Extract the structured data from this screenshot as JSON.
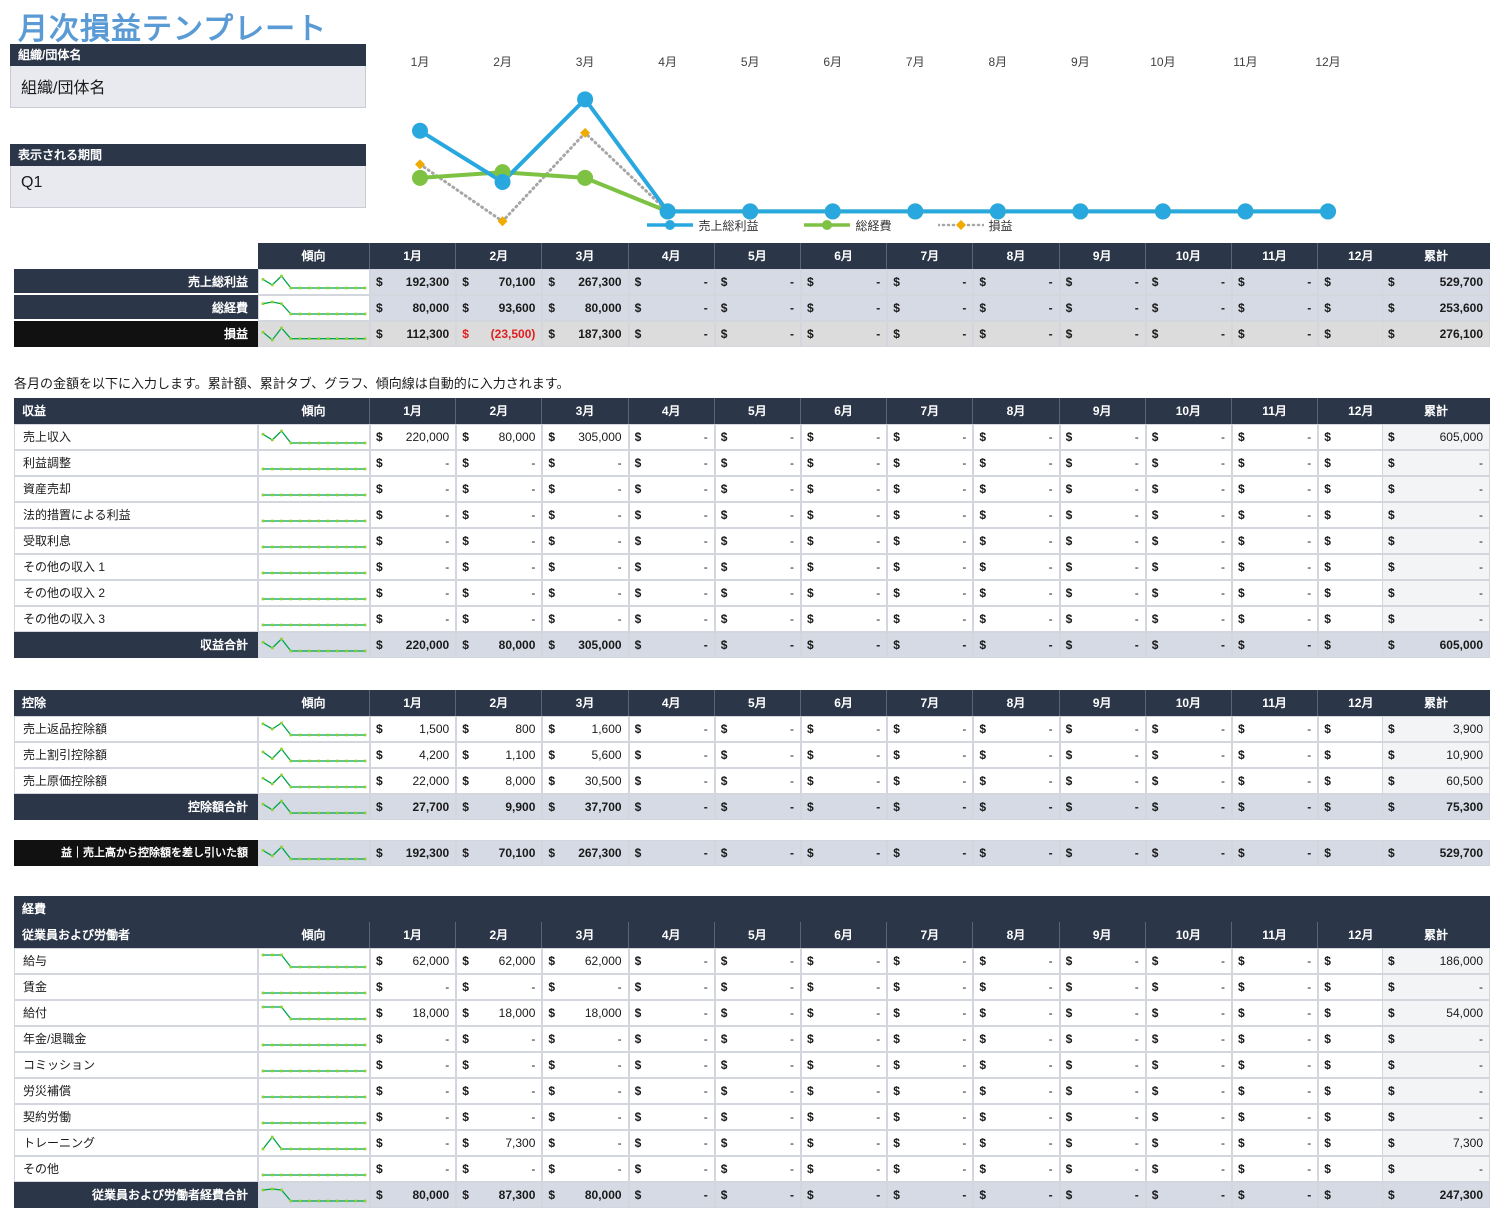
{
  "page": {
    "title": "月次損益テンプレート",
    "currency_symbol": "$",
    "dash": "-",
    "note": "各月の金額を以下に入力します。累計額、累計タブ、グラフ、傾向線は自動的に入力されます。"
  },
  "org_box": {
    "header": "組織/団体名",
    "value": "組織/団体名"
  },
  "period_box": {
    "header": "表示される期間",
    "value": "Q1"
  },
  "columns": {
    "trend": "傾向",
    "months": [
      "1月",
      "2月",
      "3月",
      "4月",
      "5月",
      "6月",
      "7月",
      "8月",
      "9月",
      "10月",
      "11月",
      "12月"
    ],
    "total": "累計"
  },
  "chart_data": {
    "type": "line",
    "title": "",
    "xlabel": "",
    "ylabel": "",
    "x": [
      "1月",
      "2月",
      "3月",
      "4月",
      "5月",
      "6月",
      "7月",
      "8月",
      "9月",
      "10月",
      "11月",
      "12月"
    ],
    "legend_position": "bottom",
    "grid": false,
    "ylim": [
      -30000,
      280000
    ],
    "series": [
      {
        "name": "売上総利益",
        "color": "#29a8e0",
        "marker": "circle",
        "style": "solid",
        "values": [
          192300,
          70100,
          267300,
          0,
          0,
          0,
          0,
          0,
          0,
          0,
          0,
          0
        ]
      },
      {
        "name": "総経費",
        "color": "#7dc242",
        "marker": "circle",
        "style": "solid",
        "values": [
          80000,
          93600,
          80000,
          0,
          0,
          0,
          0,
          0,
          0,
          0,
          0,
          0
        ]
      },
      {
        "name": "損益",
        "color": "#f0ab00",
        "marker": "diamond",
        "style": "dotted",
        "values": [
          112300,
          -23500,
          187300,
          0,
          0,
          0,
          0,
          0,
          0,
          0,
          0,
          0
        ]
      }
    ]
  },
  "summary_table": {
    "rows": [
      {
        "label": "売上総利益",
        "style": "dark",
        "values": [
          "192,300",
          "70,100",
          "267,300",
          "-",
          "-",
          "-",
          "-",
          "-",
          "-",
          "-",
          "-",
          "-"
        ],
        "total": "529,700",
        "negatives": []
      },
      {
        "label": "総経費",
        "style": "dark",
        "values": [
          "80,000",
          "93,600",
          "80,000",
          "-",
          "-",
          "-",
          "-",
          "-",
          "-",
          "-",
          "-",
          "-"
        ],
        "total": "253,600",
        "negatives": []
      },
      {
        "label": "損益",
        "style": "black",
        "values": [
          "112,300",
          "(23,500)",
          "187,300",
          "-",
          "-",
          "-",
          "-",
          "-",
          "-",
          "-",
          "-",
          "-"
        ],
        "total": "276,100",
        "negatives": [
          1
        ]
      }
    ]
  },
  "revenue_table": {
    "section_label": "収益",
    "rows": [
      {
        "label": "売上収入",
        "values": [
          "220,000",
          "80,000",
          "305,000",
          "-",
          "-",
          "-",
          "-",
          "-",
          "-",
          "-",
          "-",
          "-"
        ],
        "total": "605,000"
      },
      {
        "label": "利益調整",
        "values": [
          "-",
          "-",
          "-",
          "-",
          "-",
          "-",
          "-",
          "-",
          "-",
          "-",
          "-",
          "-"
        ],
        "total": "-"
      },
      {
        "label": "資産売却",
        "values": [
          "-",
          "-",
          "-",
          "-",
          "-",
          "-",
          "-",
          "-",
          "-",
          "-",
          "-",
          "-"
        ],
        "total": "-"
      },
      {
        "label": "法的措置による利益",
        "values": [
          "-",
          "-",
          "-",
          "-",
          "-",
          "-",
          "-",
          "-",
          "-",
          "-",
          "-",
          "-"
        ],
        "total": "-"
      },
      {
        "label": "受取利息",
        "values": [
          "-",
          "-",
          "-",
          "-",
          "-",
          "-",
          "-",
          "-",
          "-",
          "-",
          "-",
          "-"
        ],
        "total": "-"
      },
      {
        "label": "その他の収入 1",
        "values": [
          "-",
          "-",
          "-",
          "-",
          "-",
          "-",
          "-",
          "-",
          "-",
          "-",
          "-",
          "-"
        ],
        "total": "-"
      },
      {
        "label": "その他の収入 2",
        "values": [
          "-",
          "-",
          "-",
          "-",
          "-",
          "-",
          "-",
          "-",
          "-",
          "-",
          "-",
          "-"
        ],
        "total": "-"
      },
      {
        "label": "その他の収入 3",
        "values": [
          "-",
          "-",
          "-",
          "-",
          "-",
          "-",
          "-",
          "-",
          "-",
          "-",
          "-",
          "-"
        ],
        "total": "-"
      }
    ],
    "total_row": {
      "label": "収益合計",
      "values": [
        "220,000",
        "80,000",
        "305,000",
        "-",
        "-",
        "-",
        "-",
        "-",
        "-",
        "-",
        "-",
        "-"
      ],
      "total": "605,000"
    }
  },
  "deduction_table": {
    "section_label": "控除",
    "rows": [
      {
        "label": "売上返品控除額",
        "values": [
          "1,500",
          "800",
          "1,600",
          "-",
          "-",
          "-",
          "-",
          "-",
          "-",
          "-",
          "-",
          "-"
        ],
        "total": "3,900"
      },
      {
        "label": "売上割引控除額",
        "values": [
          "4,200",
          "1,100",
          "5,600",
          "-",
          "-",
          "-",
          "-",
          "-",
          "-",
          "-",
          "-",
          "-"
        ],
        "total": "10,900"
      },
      {
        "label": "売上原価控除額",
        "values": [
          "22,000",
          "8,000",
          "30,500",
          "-",
          "-",
          "-",
          "-",
          "-",
          "-",
          "-",
          "-",
          "-"
        ],
        "total": "60,500"
      }
    ],
    "total_row": {
      "label": "控除額合計",
      "values": [
        "27,700",
        "9,900",
        "37,700",
        "-",
        "-",
        "-",
        "-",
        "-",
        "-",
        "-",
        "-",
        "-"
      ],
      "total": "75,300"
    }
  },
  "gross_profit_row": {
    "label": "益｜売上高から控除額を差し引いた額",
    "values": [
      "192,300",
      "70,100",
      "267,300",
      "-",
      "-",
      "-",
      "-",
      "-",
      "-",
      "-",
      "-",
      "-"
    ],
    "total": "529,700"
  },
  "expense_table": {
    "section_label": "経費",
    "subsection_label": "従業員および労働者",
    "rows": [
      {
        "label": "給与",
        "values": [
          "62,000",
          "62,000",
          "62,000",
          "-",
          "-",
          "-",
          "-",
          "-",
          "-",
          "-",
          "-",
          "-"
        ],
        "total": "186,000"
      },
      {
        "label": "賃金",
        "values": [
          "-",
          "-",
          "-",
          "-",
          "-",
          "-",
          "-",
          "-",
          "-",
          "-",
          "-",
          "-"
        ],
        "total": "-"
      },
      {
        "label": "給付",
        "values": [
          "18,000",
          "18,000",
          "18,000",
          "-",
          "-",
          "-",
          "-",
          "-",
          "-",
          "-",
          "-",
          "-"
        ],
        "total": "54,000"
      },
      {
        "label": "年金/退職金",
        "values": [
          "-",
          "-",
          "-",
          "-",
          "-",
          "-",
          "-",
          "-",
          "-",
          "-",
          "-",
          "-"
        ],
        "total": "-"
      },
      {
        "label": "コミッション",
        "values": [
          "-",
          "-",
          "-",
          "-",
          "-",
          "-",
          "-",
          "-",
          "-",
          "-",
          "-",
          "-"
        ],
        "total": "-"
      },
      {
        "label": "労災補償",
        "values": [
          "-",
          "-",
          "-",
          "-",
          "-",
          "-",
          "-",
          "-",
          "-",
          "-",
          "-",
          "-"
        ],
        "total": "-"
      },
      {
        "label": "契約労働",
        "values": [
          "-",
          "-",
          "-",
          "-",
          "-",
          "-",
          "-",
          "-",
          "-",
          "-",
          "-",
          "-"
        ],
        "total": "-"
      },
      {
        "label": "トレーニング",
        "values": [
          "-",
          "7,300",
          "-",
          "-",
          "-",
          "-",
          "-",
          "-",
          "-",
          "-",
          "-",
          "-"
        ],
        "total": "7,300"
      },
      {
        "label": "その他",
        "values": [
          "-",
          "-",
          "-",
          "-",
          "-",
          "-",
          "-",
          "-",
          "-",
          "-",
          "-",
          "-"
        ],
        "total": "-"
      }
    ],
    "total_row": {
      "label": "従業員および労働者経費合計",
      "values": [
        "80,000",
        "87,300",
        "80,000",
        "-",
        "-",
        "-",
        "-",
        "-",
        "-",
        "-",
        "-",
        "-"
      ],
      "total": "247,300"
    }
  },
  "sparklines": {
    "summary": [
      [
        192300,
        70100,
        267300,
        0,
        0,
        0,
        0,
        0,
        0,
        0,
        0,
        0
      ],
      [
        80000,
        93600,
        80000,
        0,
        0,
        0,
        0,
        0,
        0,
        0,
        0,
        0
      ],
      [
        112300,
        -23500,
        187300,
        0,
        0,
        0,
        0,
        0,
        0,
        0,
        0,
        0
      ]
    ],
    "revenue": [
      [
        220000,
        80000,
        305000,
        0,
        0,
        0,
        0,
        0,
        0,
        0,
        0,
        0
      ],
      [
        0,
        0,
        0,
        0,
        0,
        0,
        0,
        0,
        0,
        0,
        0,
        0
      ],
      [
        0,
        0,
        0,
        0,
        0,
        0,
        0,
        0,
        0,
        0,
        0,
        0
      ],
      [
        0,
        0,
        0,
        0,
        0,
        0,
        0,
        0,
        0,
        0,
        0,
        0
      ],
      [
        0,
        0,
        0,
        0,
        0,
        0,
        0,
        0,
        0,
        0,
        0,
        0
      ],
      [
        0,
        0,
        0,
        0,
        0,
        0,
        0,
        0,
        0,
        0,
        0,
        0
      ],
      [
        0,
        0,
        0,
        0,
        0,
        0,
        0,
        0,
        0,
        0,
        0,
        0
      ],
      [
        0,
        0,
        0,
        0,
        0,
        0,
        0,
        0,
        0,
        0,
        0,
        0
      ],
      [
        220000,
        80000,
        305000,
        0,
        0,
        0,
        0,
        0,
        0,
        0,
        0,
        0
      ]
    ],
    "deduction": [
      [
        1500,
        800,
        1600,
        0,
        0,
        0,
        0,
        0,
        0,
        0,
        0,
        0
      ],
      [
        4200,
        1100,
        5600,
        0,
        0,
        0,
        0,
        0,
        0,
        0,
        0,
        0
      ],
      [
        22000,
        8000,
        30500,
        0,
        0,
        0,
        0,
        0,
        0,
        0,
        0,
        0
      ],
      [
        27700,
        9900,
        37700,
        0,
        0,
        0,
        0,
        0,
        0,
        0,
        0,
        0
      ]
    ],
    "gross": [
      192300,
      70100,
      267300,
      0,
      0,
      0,
      0,
      0,
      0,
      0,
      0,
      0
    ],
    "expense": [
      [
        62000,
        62000,
        62000,
        0,
        0,
        0,
        0,
        0,
        0,
        0,
        0,
        0
      ],
      [
        0,
        0,
        0,
        0,
        0,
        0,
        0,
        0,
        0,
        0,
        0,
        0
      ],
      [
        18000,
        18000,
        18000,
        0,
        0,
        0,
        0,
        0,
        0,
        0,
        0,
        0
      ],
      [
        0,
        0,
        0,
        0,
        0,
        0,
        0,
        0,
        0,
        0,
        0,
        0
      ],
      [
        0,
        0,
        0,
        0,
        0,
        0,
        0,
        0,
        0,
        0,
        0,
        0
      ],
      [
        0,
        0,
        0,
        0,
        0,
        0,
        0,
        0,
        0,
        0,
        0,
        0
      ],
      [
        0,
        0,
        0,
        0,
        0,
        0,
        0,
        0,
        0,
        0,
        0,
        0
      ],
      [
        0,
        7300,
        0,
        0,
        0,
        0,
        0,
        0,
        0,
        0,
        0,
        0
      ],
      [
        0,
        0,
        0,
        0,
        0,
        0,
        0,
        0,
        0,
        0,
        0,
        0
      ],
      [
        80000,
        87300,
        80000,
        0,
        0,
        0,
        0,
        0,
        0,
        0,
        0,
        0
      ]
    ],
    "line_color": "#00a550",
    "marker_color": "#8ed02c"
  }
}
